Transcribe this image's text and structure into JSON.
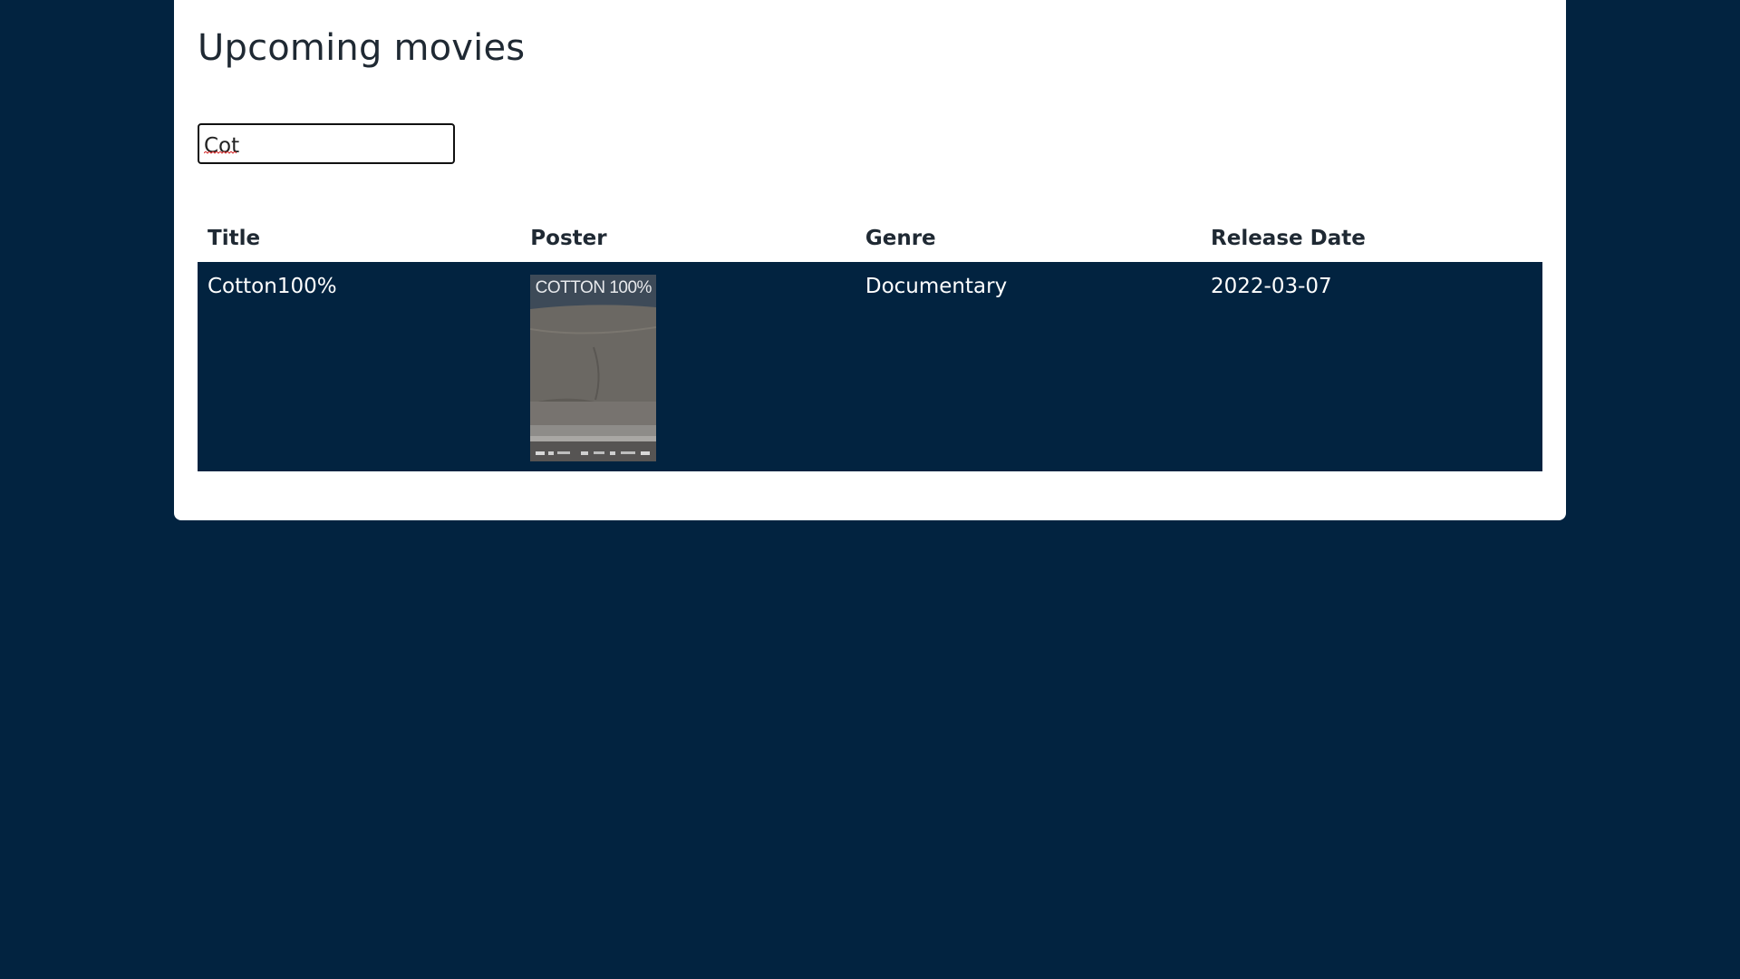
{
  "page": {
    "title": "Upcoming movies"
  },
  "search": {
    "value": "Cot"
  },
  "table": {
    "columns": [
      "Title",
      "Poster",
      "Genre",
      "Release Date"
    ],
    "rows": [
      {
        "title": "Cotton100%",
        "poster_caption": "COTTON 100%",
        "genre": "Documentary",
        "release_date": "2022-03-07"
      }
    ]
  },
  "colors": {
    "background": "#022340",
    "card": "#ffffff",
    "row_highlight": "#022340"
  }
}
